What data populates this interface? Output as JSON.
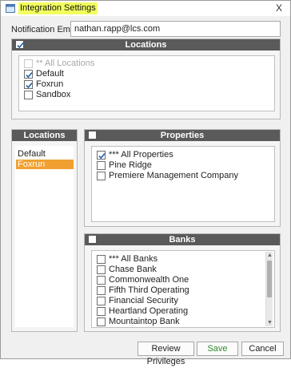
{
  "window": {
    "title": "Integration Settings",
    "close_glyph": "X"
  },
  "notification": {
    "label": "Notification Email:",
    "value": "nathan.rapp@lcs.com"
  },
  "locations_panel": {
    "header": "Locations",
    "header_checked": true,
    "items": [
      {
        "label": "** All Locations",
        "checked": false,
        "disabled": true
      },
      {
        "label": "Default",
        "checked": true,
        "disabled": false
      },
      {
        "label": "Foxrun",
        "checked": true,
        "disabled": false
      },
      {
        "label": "Sandbox",
        "checked": false,
        "disabled": false
      }
    ]
  },
  "location_list": {
    "header": "Locations",
    "items": [
      {
        "label": "Default",
        "selected": false
      },
      {
        "label": "Foxrun",
        "selected": true
      }
    ]
  },
  "properties_panel": {
    "header": "Properties",
    "header_checked": false,
    "items": [
      {
        "label": "*** All Properties",
        "checked": true
      },
      {
        "label": "Pine Ridge",
        "checked": false
      },
      {
        "label": "Premiere Management Company",
        "checked": false
      }
    ]
  },
  "banks_panel": {
    "header": "Banks",
    "header_checked": false,
    "items": [
      {
        "label": "*** All Banks",
        "checked": false
      },
      {
        "label": "Chase Bank",
        "checked": false
      },
      {
        "label": "Commonwealth One",
        "checked": false
      },
      {
        "label": "Fifth Third Operating",
        "checked": false
      },
      {
        "label": "Financial Security",
        "checked": false
      },
      {
        "label": "Heartland Operating",
        "checked": false
      },
      {
        "label": "Mountaintop Bank",
        "checked": false
      }
    ]
  },
  "footer": {
    "review_label": "Review Privileges",
    "save_label": "Save",
    "cancel_label": "Cancel"
  },
  "colors": {
    "title_highlight": "#f2ff5e",
    "header_bg": "#5a5a5a",
    "selected_bg": "#f0a030",
    "save_text": "#2e8b2e"
  }
}
